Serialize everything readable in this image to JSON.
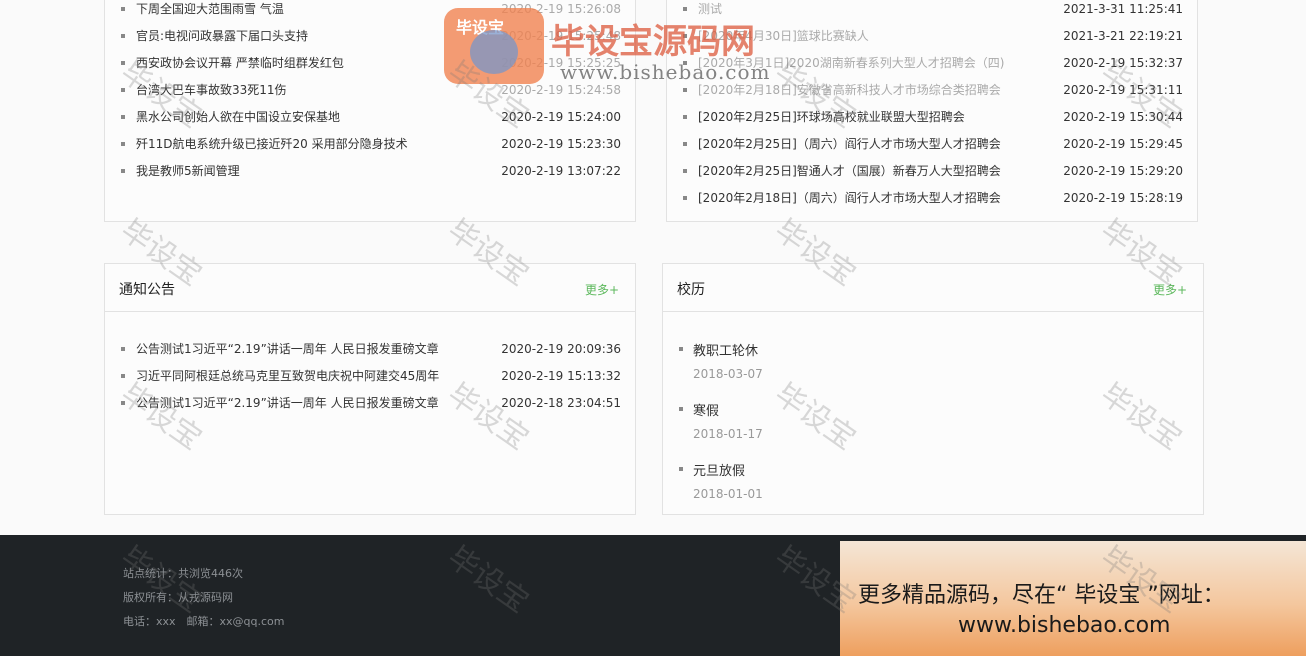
{
  "news_left": [
    {
      "title": "下周全国迎大范围雨雪 气温",
      "date": "2020-2-19 15:26:08"
    },
    {
      "title": "官员:电视问政暴露下届口头支持",
      "date": "2020-2-19 15:25:48"
    },
    {
      "title": "西安政协会议开幕 严禁临时组群发红包",
      "date": "2020-2-19 15:25:25"
    },
    {
      "title": "台湾大巴车事故致33死11伤",
      "date": "2020-2-19 15:24:58"
    },
    {
      "title": "黑水公司创始人欲在中国设立安保基地",
      "date": "2020-2-19 15:24:00"
    },
    {
      "title": "歼11D航电系统升级已接近歼20 采用部分隐身技术",
      "date": "2020-2-19 15:23:30"
    },
    {
      "title": "我是教师5新闻管理",
      "date": "2020-2-19 13:07:22"
    }
  ],
  "news_right": [
    {
      "title": "测试",
      "date": "2021-3-31 11:25:41"
    },
    {
      "title": "[2020年4月30日]篮球比赛缺人",
      "date": "2021-3-21 22:19:21"
    },
    {
      "title": "[2020年3月1日]2020湖南新春系列大型人才招聘会（四)",
      "date": "2020-2-19 15:32:37"
    },
    {
      "title": "[2020年2月18日]安徽省高新科技人才市场综合类招聘会",
      "date": "2020-2-19 15:31:11"
    },
    {
      "title": "[2020年2月25日]环球场高校就业联盟大型招聘会",
      "date": "2020-2-19 15:30:44"
    },
    {
      "title": "[2020年2月25日]（周六）阎行人才市场大型人才招聘会",
      "date": "2020-2-19 15:29:45"
    },
    {
      "title": "[2020年2月25日]智通人才（国展）新春万人大型招聘会",
      "date": "2020-2-19 15:29:20"
    },
    {
      "title": "[2020年2月18日]（周六）阎行人才市场大型人才招聘会",
      "date": "2020-2-19 15:28:19"
    }
  ],
  "notice": {
    "title": "通知公告",
    "more": "更多+",
    "items": [
      {
        "title": "公告测试1习近平“2.19”讲话一周年 人民日报发重磅文章",
        "date": "2020-2-19 20:09:36"
      },
      {
        "title": "习近平同阿根廷总统马克里互致贺电庆祝中阿建交45周年",
        "date": "2020-2-19 15:13:32"
      },
      {
        "title": "公告测试1习近平“2.19”讲话一周年 人民日报发重磅文章",
        "date": "2020-2-18 23:04:51"
      }
    ]
  },
  "calendar": {
    "title": "校历",
    "more": "更多+",
    "items": [
      {
        "name": "教职工轮休",
        "date": "2018-03-07"
      },
      {
        "name": "寒假",
        "date": "2018-01-17"
      },
      {
        "name": "元旦放假",
        "date": "2018-01-01"
      }
    ]
  },
  "footer": {
    "stats": "站点统计：共浏览446次",
    "copyright": "版权所有：从戎源码网",
    "contact": "电话：xxx　邮箱：xx@qq.com"
  },
  "watermark": {
    "badge_text": "毕设宝",
    "title": "毕设宝源码网",
    "url": "www.bishebao.com",
    "tile_text": "毕设宝"
  },
  "promo": {
    "line1": "更多精品源码，尽在“ 毕设宝 ”网址：",
    "line2": "www.bishebao.com"
  },
  "colors": {
    "more_link": "#5cb85c",
    "footer_bg": "#1f2326"
  }
}
